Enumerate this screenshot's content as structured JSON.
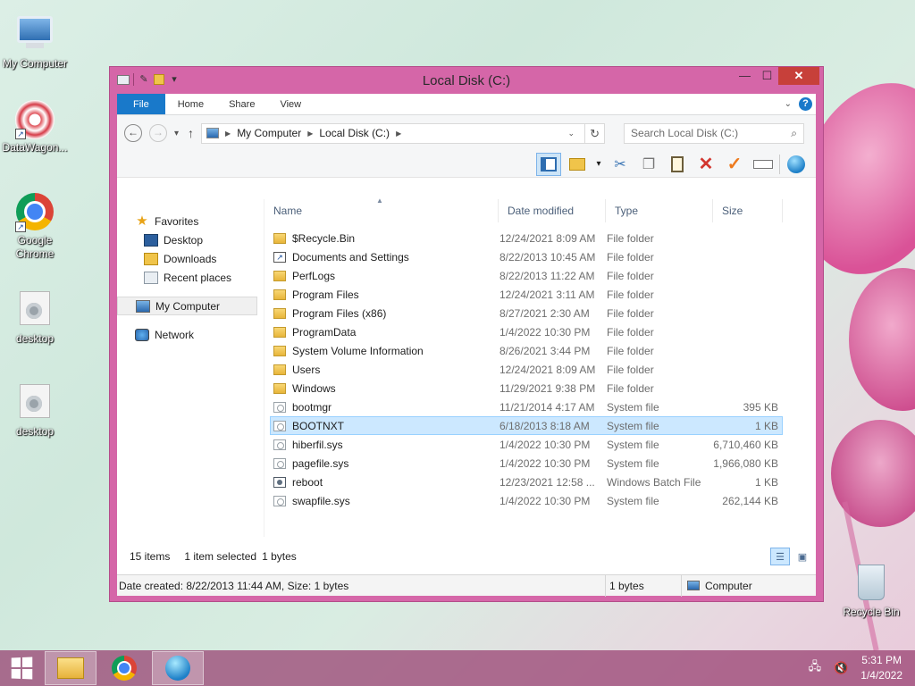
{
  "desktop": {
    "icons": [
      {
        "label": "My Computer",
        "icon": "computer-icon"
      },
      {
        "label": "DataWagon...",
        "icon": "datawagon-icon"
      },
      {
        "label": "Google Chrome",
        "icon": "chrome-icon"
      },
      {
        "label": "desktop",
        "icon": "settings-file-icon"
      },
      {
        "label": "desktop",
        "icon": "settings-file-icon"
      },
      {
        "label": "Recycle Bin",
        "icon": "recycle-bin-icon"
      }
    ]
  },
  "window": {
    "title": "Local Disk (C:)",
    "controls": {
      "minimize": "—",
      "maximize": "☐",
      "close": "✕"
    },
    "ribbon_tabs": [
      "File",
      "Home",
      "Share",
      "View"
    ],
    "address": {
      "crumbs": [
        "My Computer",
        "Local Disk (C:)"
      ],
      "search_placeholder": "Search Local Disk (C:)"
    },
    "nav": {
      "favorites_label": "Favorites",
      "favorites": [
        "Desktop",
        "Downloads",
        "Recent places"
      ],
      "computer": "My Computer",
      "network": "Network"
    },
    "columns": {
      "name": "Name",
      "date": "Date modified",
      "type": "Type",
      "size": "Size"
    },
    "files": [
      {
        "name": "$Recycle.Bin",
        "date": "12/24/2021 8:09 AM",
        "type": "File folder",
        "size": "",
        "icon": "folder"
      },
      {
        "name": "Documents and Settings",
        "date": "8/22/2013 10:45 AM",
        "type": "File folder",
        "size": "",
        "icon": "link"
      },
      {
        "name": "PerfLogs",
        "date": "8/22/2013 11:22 AM",
        "type": "File folder",
        "size": "",
        "icon": "folder"
      },
      {
        "name": "Program Files",
        "date": "12/24/2021 3:11 AM",
        "type": "File folder",
        "size": "",
        "icon": "folder"
      },
      {
        "name": "Program Files (x86)",
        "date": "8/27/2021 2:30 AM",
        "type": "File folder",
        "size": "",
        "icon": "folder"
      },
      {
        "name": "ProgramData",
        "date": "1/4/2022 10:30 PM",
        "type": "File folder",
        "size": "",
        "icon": "folder"
      },
      {
        "name": "System Volume Information",
        "date": "8/26/2021 3:44 PM",
        "type": "File folder",
        "size": "",
        "icon": "folder"
      },
      {
        "name": "Users",
        "date": "12/24/2021 8:09 AM",
        "type": "File folder",
        "size": "",
        "icon": "folder"
      },
      {
        "name": "Windows",
        "date": "11/29/2021 9:38 PM",
        "type": "File folder",
        "size": "",
        "icon": "folder"
      },
      {
        "name": "bootmgr",
        "date": "11/21/2014 4:17 AM",
        "type": "System file",
        "size": "395 KB",
        "icon": "sysf"
      },
      {
        "name": "BOOTNXT",
        "date": "6/18/2013 8:18 AM",
        "type": "System file",
        "size": "1 KB",
        "icon": "sysf",
        "selected": true
      },
      {
        "name": "hiberfil.sys",
        "date": "1/4/2022 10:30 PM",
        "type": "System file",
        "size": "6,710,460 KB",
        "icon": "sysf"
      },
      {
        "name": "pagefile.sys",
        "date": "1/4/2022 10:30 PM",
        "type": "System file",
        "size": "1,966,080 KB",
        "icon": "sysf"
      },
      {
        "name": "reboot",
        "date": "12/23/2021 12:58 ...",
        "type": "Windows Batch File",
        "size": "1 KB",
        "icon": "bat"
      },
      {
        "name": "swapfile.sys",
        "date": "1/4/2022 10:30 PM",
        "type": "System file",
        "size": "262,144 KB",
        "icon": "sysf"
      }
    ],
    "status": {
      "count": "15 items",
      "selected": "1 item selected",
      "bytes": "1 bytes"
    },
    "details": {
      "info": "Date created: 8/22/2013 11:44 AM, Size: 1 bytes",
      "size": "1 bytes",
      "location": "Computer"
    }
  },
  "taskbar": {
    "time": "5:31 PM",
    "date": "1/4/2022"
  }
}
